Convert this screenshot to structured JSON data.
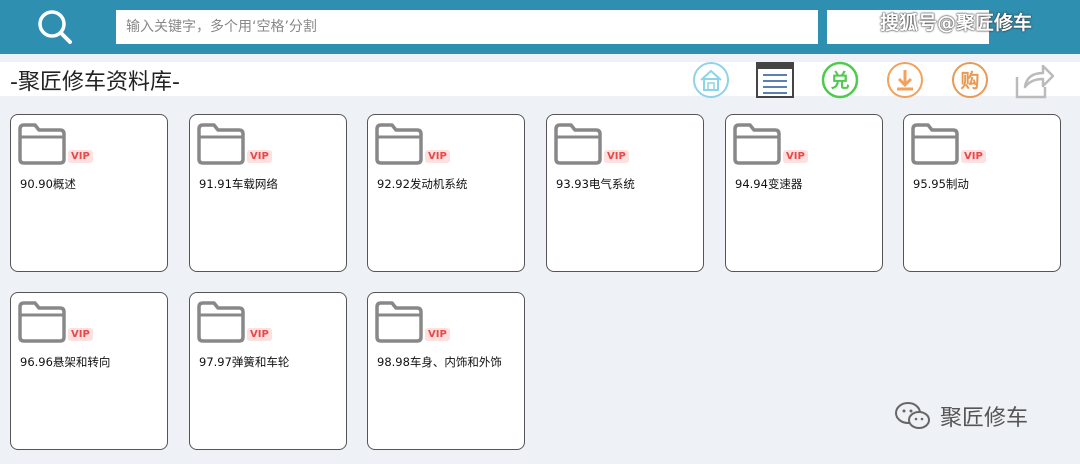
{
  "search": {
    "placeholder": "输入关键字，多个用‘空格’分割",
    "value": ""
  },
  "watermark_top": "搜狐号@聚匠修车",
  "library_title": "-聚匠修车资料库-",
  "toolbar": {
    "home_icon": "home-icon",
    "list_icon": "list-icon",
    "redeem_char": "兑",
    "download_icon": "download-icon",
    "buy_char": "购",
    "share_icon": "share-icon"
  },
  "colors": {
    "topbar": "#2f8fb0",
    "vip": "#e84848",
    "home": "#8fd3e6",
    "redeem": "#4fc94f",
    "download": "#f2a25c",
    "buy": "#e89a55"
  },
  "folders": [
    {
      "label": "90.90概述",
      "badge": "VIP"
    },
    {
      "label": "91.91车载网络",
      "badge": "VIP"
    },
    {
      "label": "92.92发动机系统",
      "badge": "VIP"
    },
    {
      "label": "93.93电气系统",
      "badge": "VIP"
    },
    {
      "label": "94.94变速器",
      "badge": "VIP"
    },
    {
      "label": "95.95制动",
      "badge": "VIP"
    },
    {
      "label": "96.96悬架和转向",
      "badge": "VIP"
    },
    {
      "label": "97.97弹簧和车轮",
      "badge": "VIP"
    },
    {
      "label": "98.98车身、内饰和外饰",
      "badge": "VIP"
    }
  ],
  "watermark_bottom": "聚匠修车"
}
